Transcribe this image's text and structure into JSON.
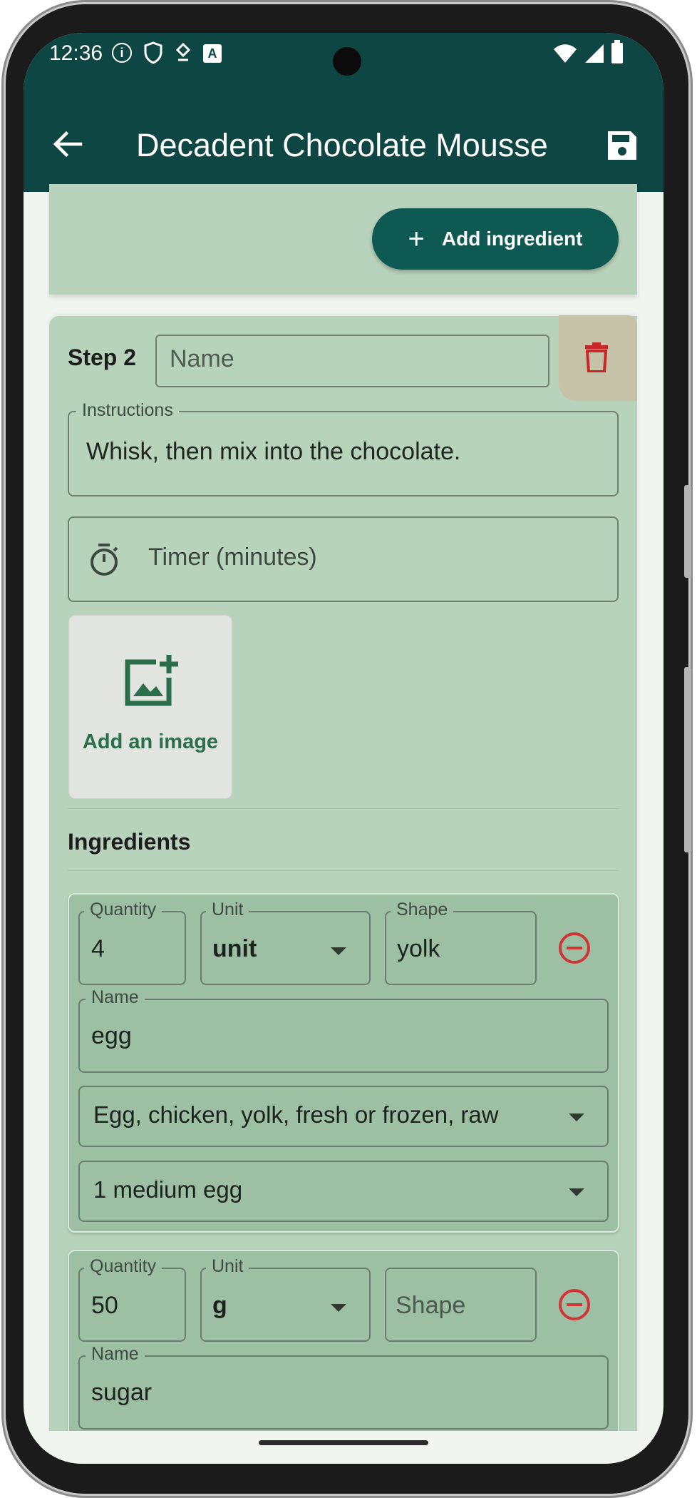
{
  "status_bar": {
    "time": "12:36",
    "left_icons": [
      "info-icon",
      "shield-icon",
      "location-icon",
      "font-icon"
    ],
    "right_icons": [
      "wifi-icon",
      "signal-icon",
      "battery-icon"
    ]
  },
  "app_bar": {
    "title": "Decadent Chocolate Mousse",
    "back_icon": "arrow-back-icon",
    "save_icon": "save-icon",
    "color": "#0e4643"
  },
  "top_card": {
    "add_ingredient_label": "Add ingredient"
  },
  "step": {
    "label": "Step 2",
    "name_placeholder": "Name",
    "instructions_label": "Instructions",
    "instructions_value": "Whisk, then mix into the chocolate.",
    "timer_placeholder": "Timer (minutes)",
    "add_image_label": "Add an image",
    "ingredients_heading": "Ingredients"
  },
  "ingredients": [
    {
      "quantity_label": "Quantity",
      "quantity": "4",
      "unit_label": "Unit",
      "unit": "unit",
      "shape_label": "Shape",
      "shape": "yolk",
      "name_label": "Name",
      "name": "egg",
      "food_match": "Egg, chicken, yolk, fresh or frozen, raw",
      "portion": "1 medium egg"
    },
    {
      "quantity_label": "Quantity",
      "quantity": "50",
      "unit_label": "Unit",
      "unit": "g",
      "shape_placeholder": "Shape",
      "name_label": "Name",
      "name": "sugar"
    }
  ],
  "colors": {
    "primary": "#0e4643",
    "card": "#b8d3bb",
    "ingredient_card": "#9dc0a4",
    "delete_red": "#c62828"
  }
}
